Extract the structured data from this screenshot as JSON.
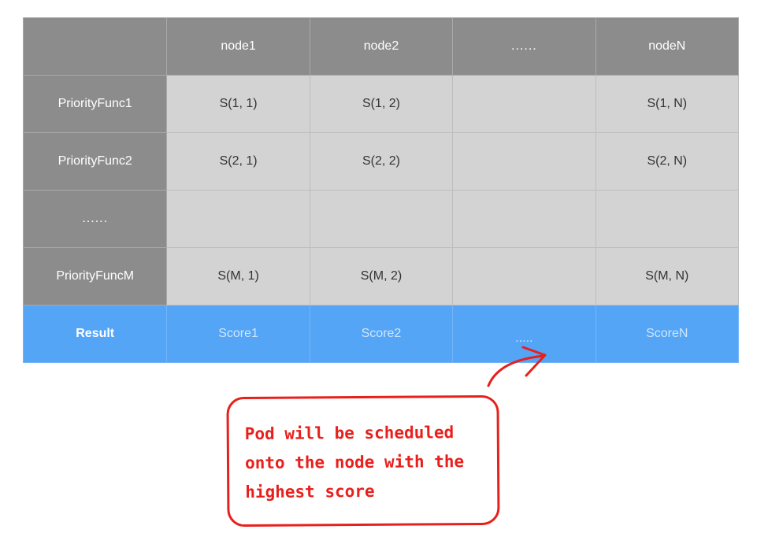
{
  "table": {
    "header": [
      "",
      "node1",
      "node2",
      "......",
      "nodeN"
    ],
    "rows": [
      {
        "label": "PriorityFunc1",
        "cells": [
          "S(1, 1)",
          "S(1, 2)",
          "",
          "S(1, N)"
        ]
      },
      {
        "label": "PriorityFunc2",
        "cells": [
          "S(2, 1)",
          "S(2, 2)",
          "",
          "S(2, N)"
        ]
      },
      {
        "label": "......",
        "cells": [
          "",
          "",
          "",
          ""
        ]
      },
      {
        "label": "PriorityFuncM",
        "cells": [
          "S(M, 1)",
          "S(M, 2)",
          "",
          "S(M, N)"
        ]
      }
    ],
    "result": {
      "label": "Result",
      "cells": [
        "Score1",
        "Score2",
        ".....",
        "ScoreN"
      ]
    }
  },
  "callout": {
    "text": "Pod will be scheduled onto the node with the highest score"
  },
  "colors": {
    "header_bg": "#8c8c8c",
    "cell_bg": "#d3d3d3",
    "result_bg": "#55a5f7",
    "callout_red": "#e8201c"
  },
  "icons": {
    "arrow": "curved-arrow-icon"
  }
}
